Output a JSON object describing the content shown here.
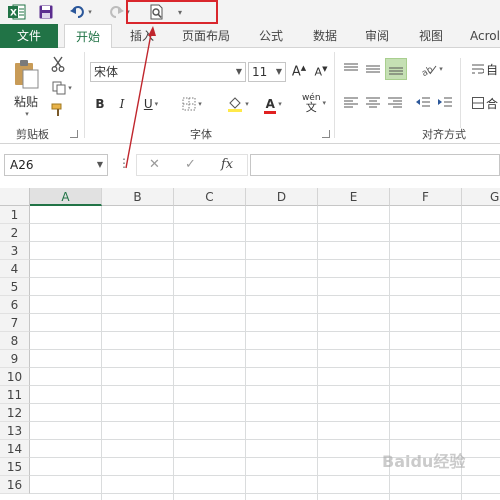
{
  "qat": {
    "undo_caret": "▾",
    "redo_caret": "▾",
    "customize_caret": "▾"
  },
  "tabs": [
    {
      "label": "文件"
    },
    {
      "label": "开始"
    },
    {
      "label": "插入"
    },
    {
      "label": "页面布局"
    },
    {
      "label": "公式"
    },
    {
      "label": "数据"
    },
    {
      "label": "审阅"
    },
    {
      "label": "视图"
    },
    {
      "label": "Acrol"
    }
  ],
  "ribbon": {
    "clipboard": {
      "paste_label": "粘贴",
      "group_label": "剪贴板"
    },
    "font": {
      "font_name": "宋体",
      "font_size": "11",
      "bold": "B",
      "italic": "I",
      "underline": "U",
      "font_color_letter": "A",
      "phonetic": "wén",
      "group_label": "字体"
    },
    "alignment": {
      "group_label": "对齐方式",
      "wrap_label": "自",
      "merge_label": "合"
    }
  },
  "formula_bar": {
    "name_box": "A26",
    "fx_label": "fx",
    "cancel_symbol": "✕",
    "enter_symbol": "✓"
  },
  "grid": {
    "columns": [
      "A",
      "B",
      "C",
      "D",
      "E",
      "F",
      "G"
    ],
    "rows": [
      "1",
      "2",
      "3",
      "4",
      "5",
      "6",
      "7",
      "8",
      "9",
      "10",
      "11",
      "12",
      "13",
      "14",
      "15",
      "16"
    ]
  },
  "colors": {
    "excel_green": "#217346",
    "highlight_red": "#d9262c"
  },
  "watermark": "Baidu经验"
}
